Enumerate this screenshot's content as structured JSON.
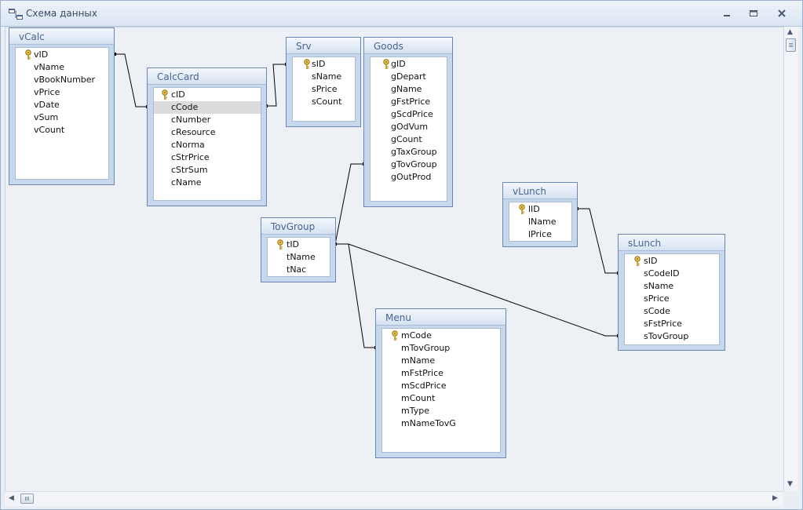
{
  "window": {
    "title": "Схема данных",
    "icon": "relationships-icon"
  },
  "scroll": {
    "up": "▲",
    "down": "▼",
    "left": "◀",
    "right": "▶"
  },
  "tables": [
    {
      "id": "vCalc",
      "title": "vCalc",
      "key": "vID",
      "fields": [
        "vName",
        "vBookNumber",
        "vPrice",
        "vDate",
        "vSum",
        "vCount"
      ]
    },
    {
      "id": "CalcCard",
      "title": "CalcCard",
      "key": "cID",
      "fields": [
        "cCode",
        "cNumber",
        "cResource",
        "cNorma",
        "cStrPrice",
        "cStrSum",
        "cName"
      ],
      "selected_field": "cCode"
    },
    {
      "id": "Srv",
      "title": "Srv",
      "key": "sID",
      "fields": [
        "sName",
        "sPrice",
        "sCount"
      ]
    },
    {
      "id": "Goods",
      "title": "Goods",
      "key": "gID",
      "fields": [
        "gDepart",
        "gName",
        "gFstPrice",
        "gScdPrice",
        "gOdVum",
        "gCount",
        "gTaxGroup",
        "gTovGroup",
        "gOutProd"
      ]
    },
    {
      "id": "TovGroup",
      "title": "TovGroup",
      "key": "tID",
      "fields": [
        "tName",
        "tNac"
      ]
    },
    {
      "id": "Menu",
      "title": "Menu",
      "key": "mCode",
      "fields": [
        "mTovGroup",
        "mName",
        "mFstPrice",
        "mScdPrice",
        "mCount",
        "mType",
        "mNameTovG"
      ]
    },
    {
      "id": "vLunch",
      "title": "vLunch",
      "key": "lID",
      "fields": [
        "lName",
        "lPrice"
      ]
    },
    {
      "id": "sLunch",
      "title": "sLunch",
      "key": "sID",
      "fields": [
        "sCodeID",
        "sName",
        "sPrice",
        "sCode",
        "sFstPrice",
        "sTovGroup"
      ]
    }
  ]
}
